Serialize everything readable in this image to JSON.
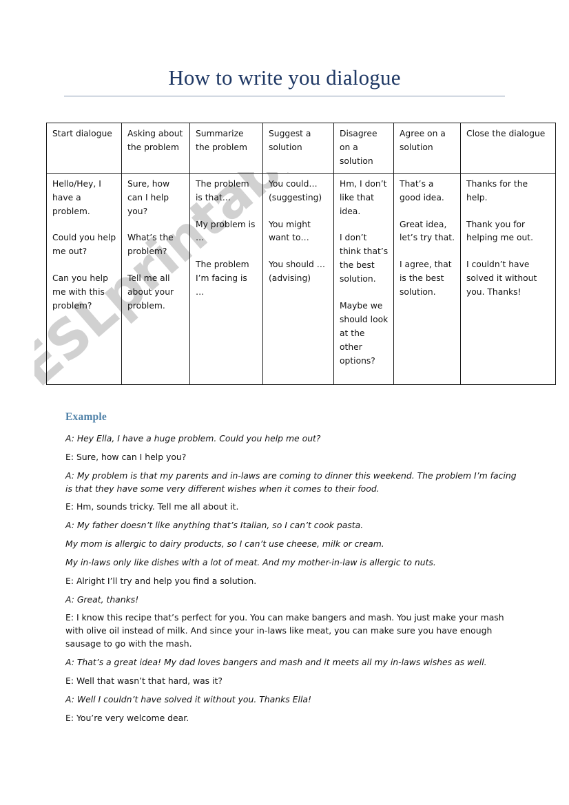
{
  "document": {
    "title": "How to write you dialogue",
    "watermark": "ESLprintables.com",
    "accent_title_color": "#1f3864",
    "accent_heading_color": "#4f81a8",
    "rule_color": "#8496b0"
  },
  "phrase_table": {
    "headers": [
      "Start dialogue",
      "Asking about the problem",
      "Summarize the problem",
      "Suggest a solution",
      "Disagree on a solution",
      "Agree on a solution",
      "Close the dialogue"
    ],
    "columns": [
      [
        "Hello/Hey, I have a problem.",
        "Could you help me out?",
        "Can you help me with this problem?"
      ],
      [
        "Sure, how can I help you?",
        "What’s the problem?",
        "Tell me all about your problem."
      ],
      [
        "The problem is that…",
        "My problem is …",
        "The problem I’m facing is …"
      ],
      [
        "You could… (suggesting)",
        "You might want to…",
        "You should … (advising)"
      ],
      [
        "Hm, I don’t like that idea.",
        "I don’t think that’s the best solution.",
        "Maybe we should look at the other options?"
      ],
      [
        "That’s a good idea.",
        "Great idea, let’s try that.",
        "I agree, that is the best solution."
      ],
      [
        "Thanks for the help.",
        "Thank you for helping me out.",
        "I couldn’t have solved it without you. Thanks!"
      ]
    ]
  },
  "example": {
    "heading": "Example",
    "lines": [
      {
        "text": "A: Hey Ella, I have a huge problem. Could you help me out?",
        "italic": true
      },
      {
        "text": "E: Sure, how can I help you?",
        "italic": false
      },
      {
        "text": "A: My problem is that my parents and in-laws are coming to dinner this weekend. The problem I’m facing is that they have some very different wishes when it comes to their food.",
        "italic": true
      },
      {
        "text": "E: Hm, sounds tricky. Tell me all about it.",
        "italic": false
      },
      {
        "text": "A: My father doesn’t like anything that’s Italian, so I can’t cook pasta.",
        "italic": true
      },
      {
        "text": "My mom is allergic to dairy products, so I can’t use cheese, milk or cream.",
        "italic": true
      },
      {
        "text": "My in-laws only like dishes with a lot of meat. And my mother-in-law is allergic to nuts.",
        "italic": true
      },
      {
        "text": "E: Alright I’ll try and help you find a solution.",
        "italic": false
      },
      {
        "text": "A: Great, thanks!",
        "italic": true
      },
      {
        "text": "E: I know this recipe that’s perfect for you. You can make bangers and mash. You just make your mash with olive oil instead of milk. And since your in-laws like meat, you can make sure you have enough sausage to go with the mash.",
        "italic": false
      },
      {
        "text": "A: That’s a great idea! My dad loves bangers and mash and it meets all my in-laws wishes as well.",
        "italic": true
      },
      {
        "text": "E: Well that wasn’t that hard, was it?",
        "italic": false
      },
      {
        "text": "A: Well I couldn’t have solved it without you. Thanks Ella!",
        "italic": true
      },
      {
        "text": "E: You’re very welcome dear.",
        "italic": false
      }
    ]
  }
}
